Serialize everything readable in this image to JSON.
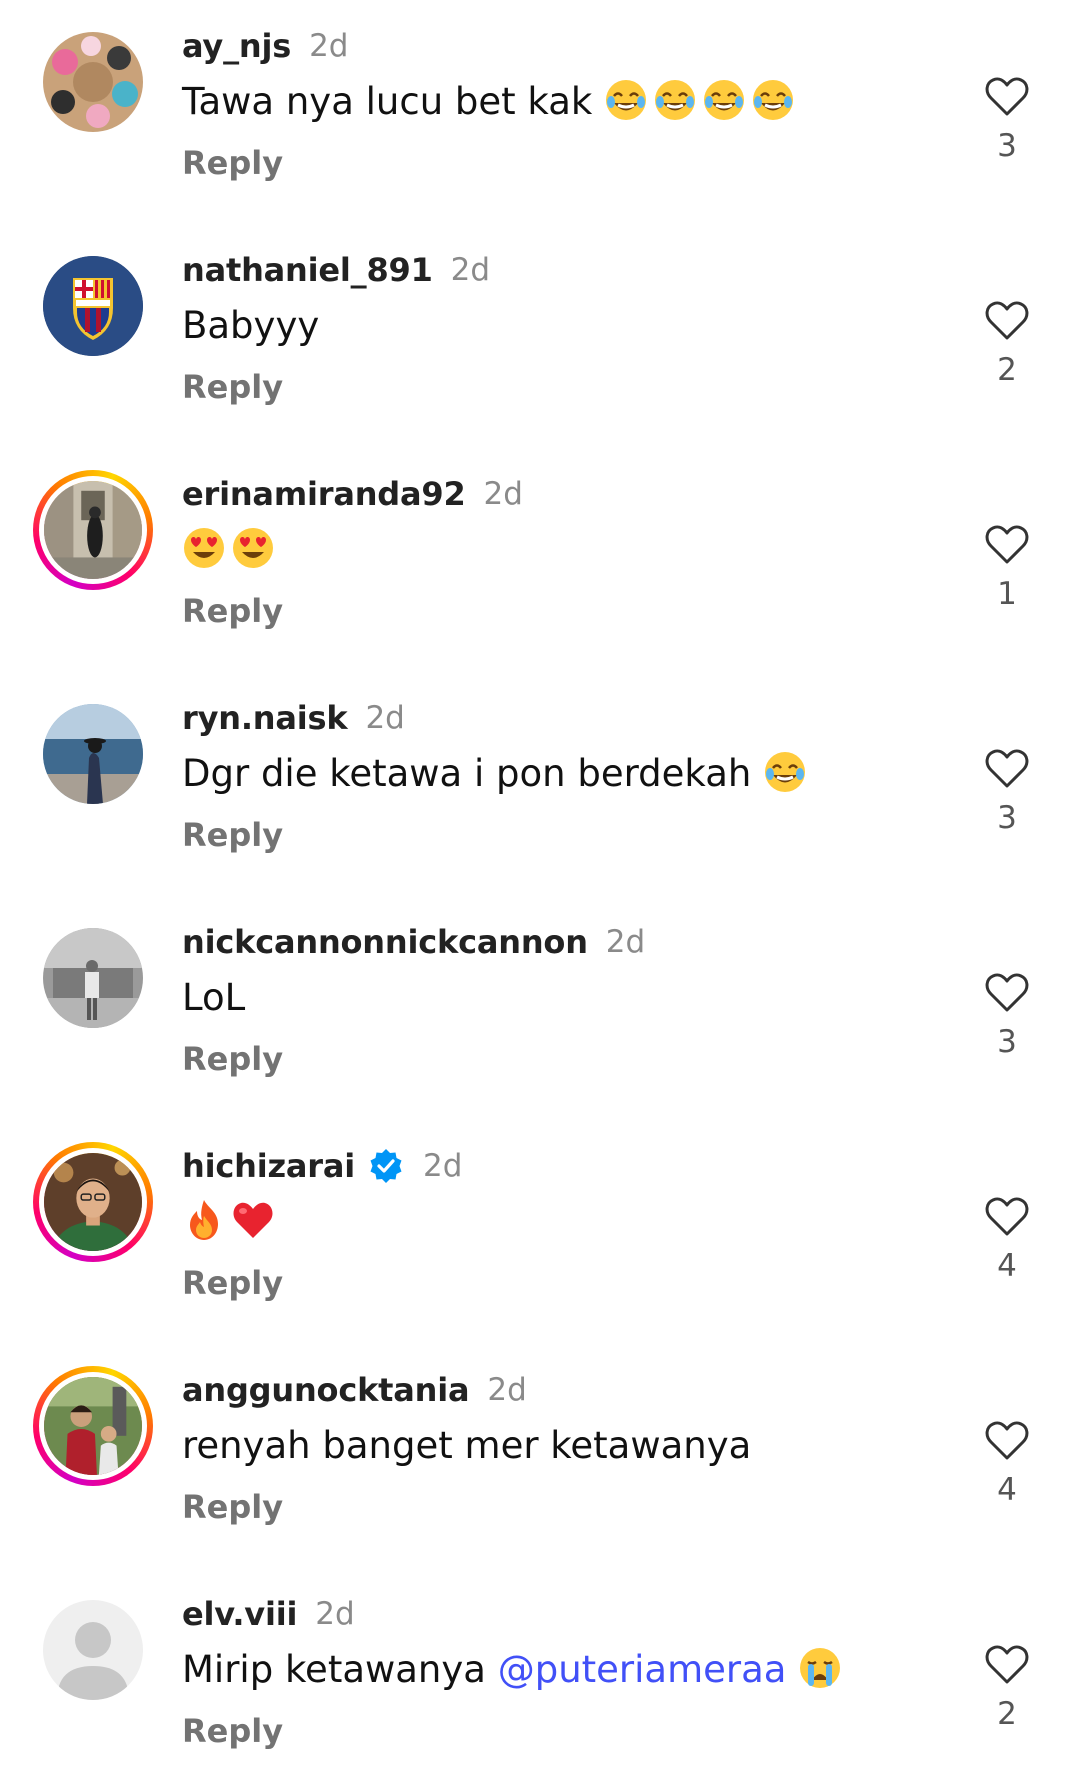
{
  "reply_label": "Reply",
  "colors": {
    "mention": "#4150f7",
    "verified": "#0095f6",
    "story_ring": [
      "#d300c5",
      "#ff0069",
      "#ff7a00",
      "#ffd600"
    ]
  },
  "comments": [
    {
      "username": "ay_njs",
      "time": "2d",
      "text": "Tawa nya lucu bet kak ",
      "emojis": [
        "joy-emoji",
        "joy-emoji",
        "joy-emoji",
        "joy-emoji"
      ],
      "likes": "3",
      "avatar": "group-photo-avatar",
      "story_ring": false,
      "verified": false
    },
    {
      "username": "nathaniel_891",
      "time": "2d",
      "text": "Babyyy",
      "emojis": [],
      "likes": "2",
      "avatar": "fcb-crest-avatar",
      "story_ring": false,
      "verified": false
    },
    {
      "username": "erinamiranda92",
      "time": "2d",
      "text": "",
      "emojis": [
        "heart-eyes-emoji",
        "heart-eyes-emoji"
      ],
      "likes": "1",
      "avatar": "street-photo-avatar",
      "story_ring": true,
      "verified": false
    },
    {
      "username": "ryn.naisk",
      "time": "2d",
      "text": "Dgr die ketawa i pon berdekah ",
      "emojis": [
        "joy-emoji"
      ],
      "likes": "3",
      "avatar": "beach-photo-avatar",
      "story_ring": false,
      "verified": false
    },
    {
      "username": "nickcannonnickcannon",
      "time": "2d",
      "text": "LoL",
      "emojis": [],
      "likes": "3",
      "avatar": "grayscale-photo-avatar",
      "story_ring": false,
      "verified": false
    },
    {
      "username": "hichizarai",
      "time": "2d",
      "text": "",
      "emojis": [
        "fire-emoji",
        "red-heart-emoji"
      ],
      "likes": "4",
      "avatar": "portrait-photo-avatar",
      "story_ring": true,
      "verified": true
    },
    {
      "username": "anggunocktania",
      "time": "2d",
      "text": "renyah banget mer ketawanya",
      "emojis": [],
      "likes": "4",
      "avatar": "family-photo-avatar",
      "story_ring": true,
      "verified": false
    },
    {
      "username": "elv.viii",
      "time": "2d",
      "text": "Mirip ketawanya ",
      "mention": "@puteriameraa",
      "emojis": [
        "crying-emoji"
      ],
      "likes": "2",
      "avatar": "default-user-avatar",
      "story_ring": false,
      "verified": false
    }
  ]
}
